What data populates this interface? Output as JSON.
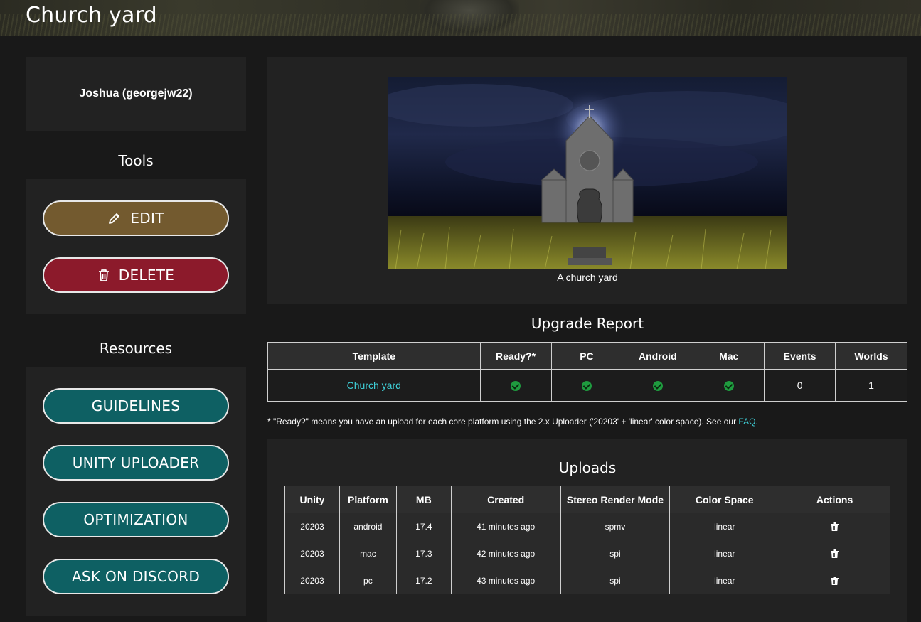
{
  "header": {
    "title": "Church yard"
  },
  "sidebar": {
    "user": "Joshua (georgejw22)",
    "tools_title": "Tools",
    "tools": [
      {
        "label": "EDIT",
        "icon": "pencil-icon",
        "color": "#735a2f"
      },
      {
        "label": "DELETE",
        "icon": "trash-icon",
        "color": "#8c1a2b"
      }
    ],
    "resources_title": "Resources",
    "resources": [
      {
        "label": "GUIDELINES"
      },
      {
        "label": "UNITY UPLOADER"
      },
      {
        "label": "OPTIMIZATION"
      },
      {
        "label": "ASK ON DISCORD"
      }
    ],
    "resource_color": "#0e6063"
  },
  "hero": {
    "caption": "A church yard"
  },
  "upgrade_report": {
    "title": "Upgrade Report",
    "columns": [
      "Template",
      "Ready?*",
      "PC",
      "Android",
      "Mac",
      "Events",
      "Worlds"
    ],
    "row": {
      "template": "Church yard",
      "ready": true,
      "pc": true,
      "android": true,
      "mac": true,
      "events": "0",
      "worlds": "1"
    },
    "note_prefix": "* \"Ready?\" means you have an upload for each core platform using the 2.x Uploader ('20203' + 'linear' color space). See our ",
    "note_link": "FAQ."
  },
  "uploads": {
    "title": "Uploads",
    "columns": [
      "Unity",
      "Platform",
      "MB",
      "Created",
      "Stereo Render Mode",
      "Color Space",
      "Actions"
    ],
    "rows": [
      {
        "unity": "20203",
        "platform": "android",
        "mb": "17.4",
        "created": "41 minutes ago",
        "stereo": "spmv",
        "color_space": "linear"
      },
      {
        "unity": "20203",
        "platform": "mac",
        "mb": "17.3",
        "created": "42 minutes ago",
        "stereo": "spi",
        "color_space": "linear"
      },
      {
        "unity": "20203",
        "platform": "pc",
        "mb": "17.2",
        "created": "43 minutes ago",
        "stereo": "spi",
        "color_space": "linear"
      }
    ]
  },
  "colors": {
    "accent_link": "#3fd0d8",
    "check": "#1f9b3f",
    "panel": "#222222",
    "background": "#191919"
  }
}
